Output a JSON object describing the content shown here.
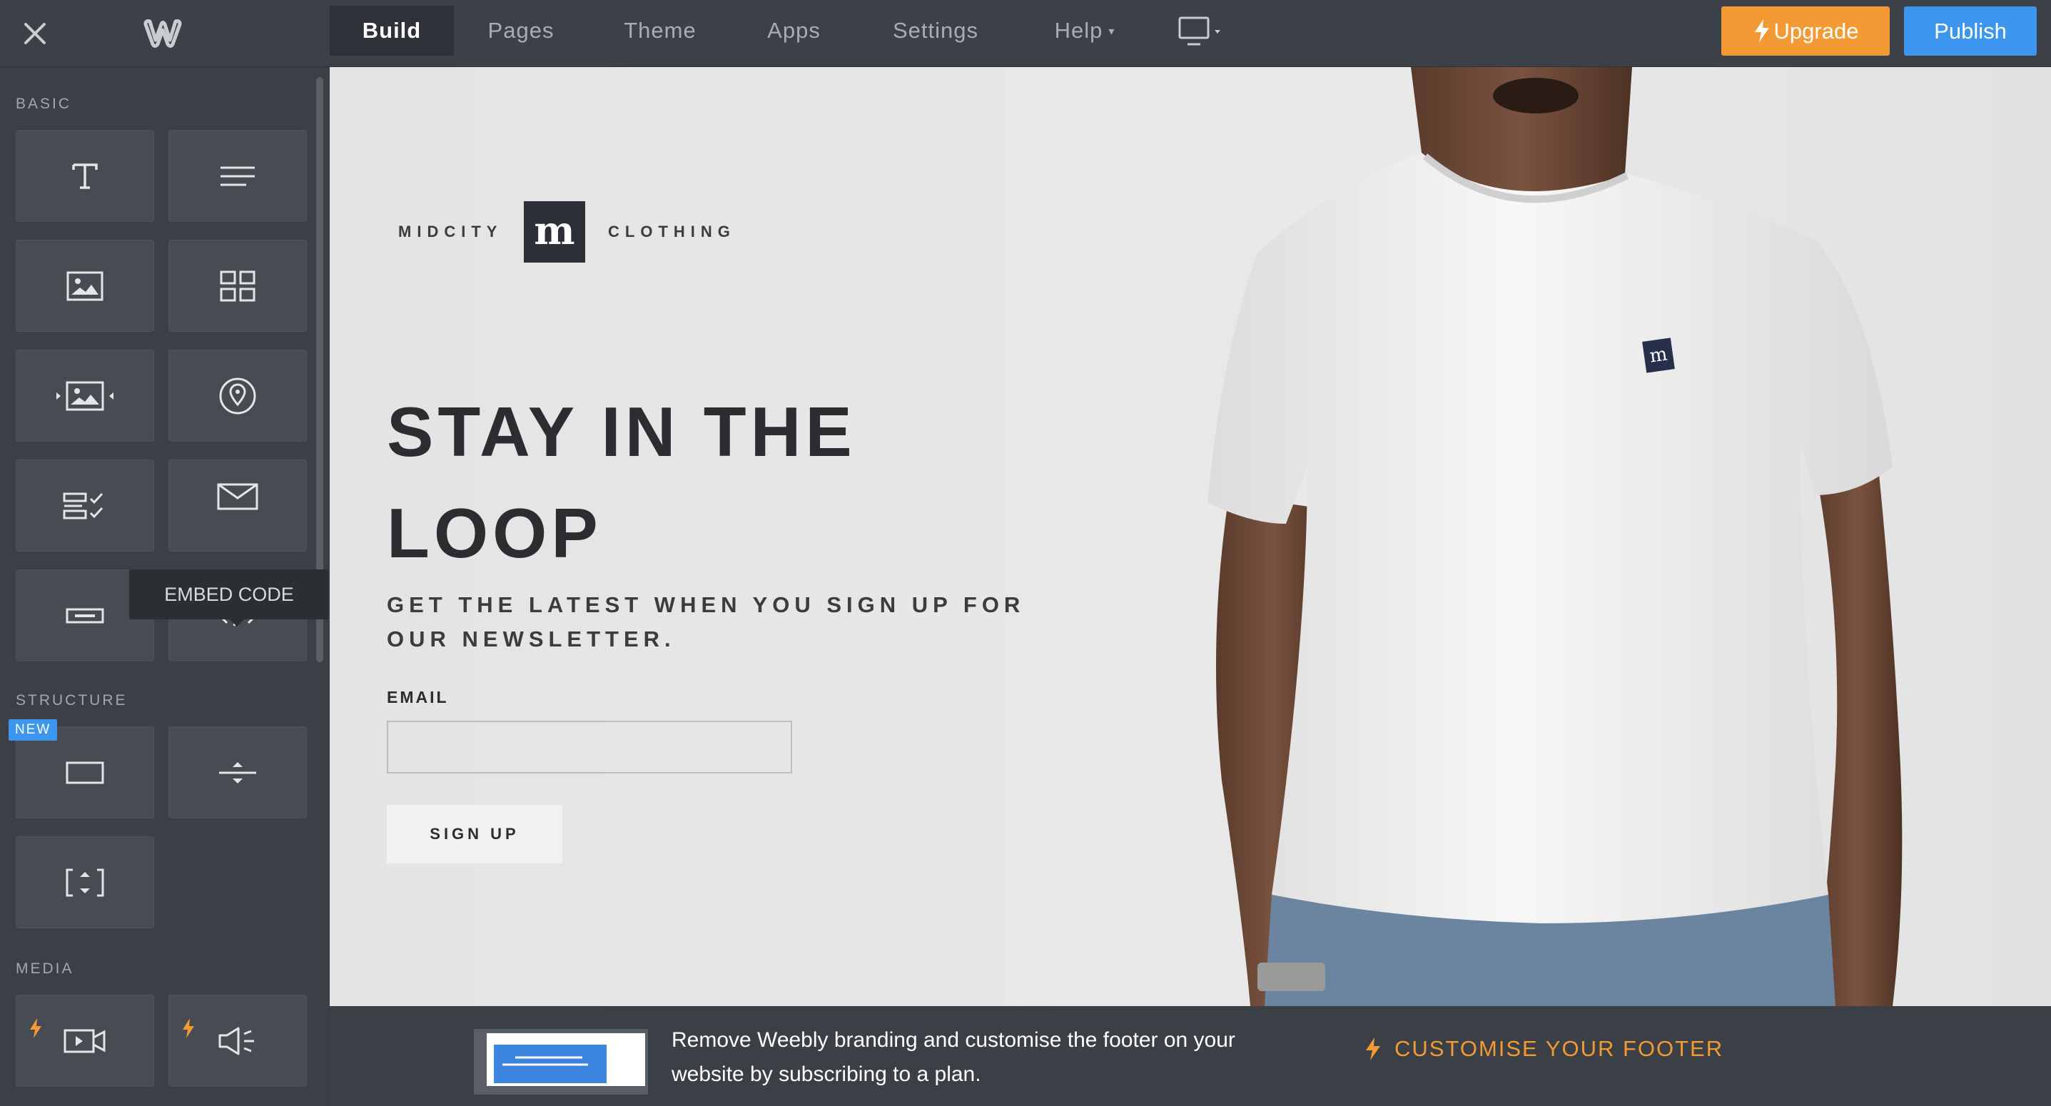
{
  "topbar": {
    "tabs": [
      {
        "label": "Build",
        "active": true
      },
      {
        "label": "Pages",
        "active": false
      },
      {
        "label": "Theme",
        "active": false
      },
      {
        "label": "Apps",
        "active": false
      },
      {
        "label": "Settings",
        "active": false
      },
      {
        "label": "Help",
        "active": false
      }
    ],
    "upgrade_label": "Upgrade",
    "publish_label": "Publish",
    "colors": {
      "upgrade": "#f39a34",
      "publish": "#3d96ee"
    }
  },
  "sidebar": {
    "sections": {
      "basic": "BASIC",
      "structure": "STRUCTURE",
      "media": "MEDIA"
    },
    "new_badge": "NEW",
    "tooltip": "EMBED CODE",
    "tile_icons": [
      "title-icon",
      "text-icon",
      "image-icon",
      "gallery-icon",
      "slideshow-icon",
      "map-icon",
      "contact-form-icon",
      "newsletter-icon",
      "button-icon",
      "embed-code-icon",
      "section-icon",
      "divider-icon",
      "spacer-icon",
      "video-icon",
      "audio-icon"
    ]
  },
  "canvas": {
    "brand_left": "MIDCITY",
    "brand_right": "CLOTHING",
    "hero_title_line1": "STAY IN THE",
    "hero_title_line2": "LOOP",
    "hero_sub_line1": "GET THE LATEST WHEN YOU SIGN UP FOR",
    "hero_sub_line2": "OUR NEWSLETTER.",
    "email_label": "EMAIL",
    "signup_label": "SIGN UP"
  },
  "footer": {
    "promo_line1": "Remove Weebly branding and customise the footer on your",
    "promo_line2": "website by subscribing to a plan.",
    "customise_label": "CUSTOMISE YOUR FOOTER",
    "accent": "#f39a34"
  }
}
